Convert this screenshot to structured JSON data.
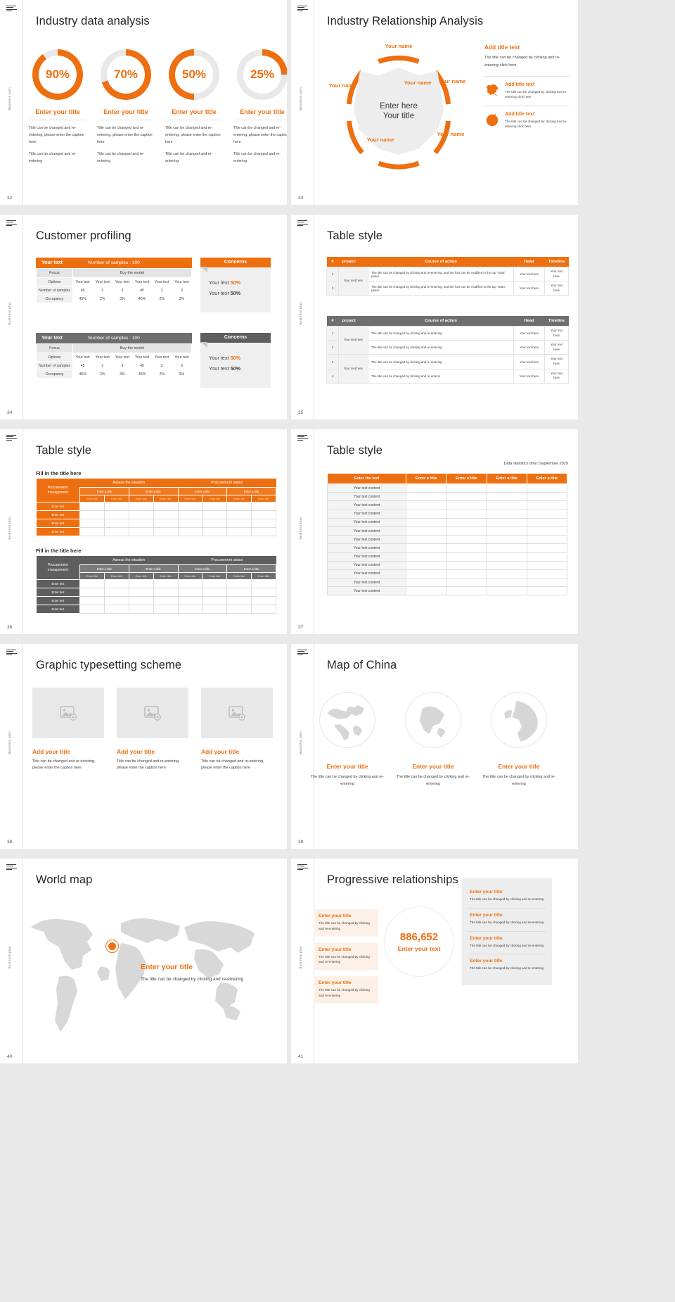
{
  "common": {
    "rail_text": "Business plan",
    "logo_name": "brand-logo"
  },
  "slides": [
    {
      "number": "32",
      "title": "Industry data analysis",
      "donuts": [
        {
          "percent": "90%",
          "value": 90,
          "title": "Enter your title",
          "body1": "Title can be changed and re-entering, please enter the caption here",
          "body2": "Title can be changed and re-entering"
        },
        {
          "percent": "70%",
          "value": 70,
          "title": "Enter your title",
          "body1": "Title can be changed and re-entering, please enter the caption here",
          "body2": "Title can be changed and re-entering"
        },
        {
          "percent": "50%",
          "value": 50,
          "title": "Enter your title",
          "body1": "Title can be changed and re-entering, please enter the caption here",
          "body2": "Title can be changed and re-entering"
        },
        {
          "percent": "25%",
          "value": 25,
          "title": "Enter your title",
          "body1": "Title can be changed and re-entering, please enter the caption here",
          "body2": "Title can be changed and re-entering"
        }
      ]
    },
    {
      "number": "33",
      "title": "Industry Relationship Analysis",
      "center_line1": "Enter here",
      "center_line2": "Your title",
      "nodes": [
        "Your name",
        "Your name",
        "Your name",
        "Your name",
        "Your name",
        "Your name"
      ],
      "right": {
        "heading": "Add title text",
        "paragraph": "The title can be changed by clicking and re-entering click here",
        "items": [
          {
            "icon": "china-map-icon",
            "heading": "Add title text",
            "paragraph": "The title can be changed by clicking and re-entering click here"
          },
          {
            "icon": "globe-icon",
            "heading": "Add title text",
            "paragraph": "The title can be changed by clicking and re-entering click here"
          }
        ]
      }
    },
    {
      "number": "34",
      "title": "Customer profiling",
      "tables": [
        {
          "accent": "#ee6f10",
          "head_left": "Your text",
          "head_right": "Number of samples : 100",
          "sub_left": "Focus",
          "sub_right": "Buy the model",
          "rows": [
            {
              "label": "Options",
              "cells": [
                "Your text",
                "Your text",
                "Your text",
                "Your text",
                "Your text",
                "Your text"
              ]
            },
            {
              "label": "Number of samples",
              "cells": [
                "45",
                "2",
                "3",
                "45",
                "2",
                "3"
              ]
            },
            {
              "label": "Occupancy",
              "cells": [
                "45%",
                "2%",
                "3%",
                "45%",
                "2%",
                "3%"
              ]
            }
          ]
        },
        {
          "accent": "#6e6e6e",
          "head_left": "Your text",
          "head_right": "Number of samples : 100",
          "sub_left": "Focus",
          "sub_right": "Buy the model",
          "rows": [
            {
              "label": "Options",
              "cells": [
                "Your text",
                "Your text",
                "Your text",
                "Your text",
                "Your text",
                "Your text"
              ]
            },
            {
              "label": "Number of samples",
              "cells": [
                "45",
                "2",
                "3",
                "45",
                "2",
                "3"
              ]
            },
            {
              "label": "Occupancy",
              "cells": [
                "45%",
                "2%",
                "3%",
                "45%",
                "2%",
                "3%"
              ]
            }
          ]
        }
      ],
      "concerns": [
        {
          "accent": "#ee6f10",
          "title": "Concerns",
          "line1_text": "Your text ",
          "line1_val": "50%",
          "line2_text": "Your text ",
          "line2_val": "50%"
        },
        {
          "accent": "#5e5e5e",
          "title": "Concerns",
          "line1_text": "Your text ",
          "line1_val": "50%",
          "line2_text": "Your text ",
          "line2_val": "50%"
        }
      ]
    },
    {
      "number": "35",
      "title": "Table style",
      "tables": [
        {
          "accent": "#ee6f10",
          "headers": [
            "#",
            "project",
            "Course of action",
            "Head",
            "Timeline"
          ],
          "rows": [
            {
              "num": "1",
              "project": "Your text here",
              "action": "The title can be changed by clicking and re-entering, and the font can be modilied in the top \"Start\" panel",
              "head": "Your text here",
              "timeline": "Your text here"
            },
            {
              "num": "2",
              "project": "",
              "action": "The title can be changed by clicking and re-entering, and the font can be modified in the top \"Start\" panel",
              "head": "Your text here",
              "timeline": "Your text here"
            }
          ]
        },
        {
          "accent": "#6e6e6e",
          "headers": [
            "#",
            "project",
            "Course of action",
            "Head",
            "Timeline"
          ],
          "rows": [
            {
              "num": "1",
              "project": "Your text here",
              "action": "The title can be changed by clicking and re-entering",
              "head": "Your text here",
              "timeline": "Your text here"
            },
            {
              "num": "2",
              "project": "",
              "action": "The title can be changed by clicking and re-entering",
              "head": "Your text here",
              "timeline": "Your text here"
            },
            {
              "num": "3",
              "project": "Your text here",
              "action": "The title can be changed by clicking and re-entering",
              "head": "Your text here",
              "timeline": "Your text here"
            },
            {
              "num": "4",
              "project": "",
              "action": "The title can be changed by clicking and re-enterin",
              "head": "Your text here",
              "timeline": "Your text here"
            }
          ]
        }
      ]
    },
    {
      "number": "36",
      "title": "Table style",
      "blocks": [
        {
          "accent": "#ee6f10",
          "caption": "Fill in the title here",
          "corner": "Procurement management",
          "groups": [
            "Assess the situation",
            "Procurement status"
          ],
          "subs": [
            "Enter a title",
            "Enter a title",
            "Enter a title",
            "Enter a title"
          ],
          "subsubs": [
            "Enter title",
            "Enter title",
            "Enter title",
            "Enter title",
            "Enter title",
            "Enter title",
            "Enter title",
            "Enter title"
          ],
          "rows": [
            "Enter text",
            "Enter text",
            "Enter text",
            "Enter text"
          ]
        },
        {
          "accent": "#5e5e5e",
          "caption": "Fill in the title here",
          "corner": "Procurement management",
          "groups": [
            "Assess the situation",
            "Procurement status"
          ],
          "subs": [
            "Enter a title",
            "Enter a title",
            "Enter a title",
            "Enter a title"
          ],
          "subsubs": [
            "Enter title",
            "Enter title",
            "Enter title",
            "Enter title",
            "Enter title",
            "Enter title",
            "Enter title",
            "Enter title"
          ],
          "rows": [
            "Enter text",
            "Enter text",
            "Enter text",
            "Enter text"
          ]
        }
      ]
    },
    {
      "number": "37",
      "title": "Table style",
      "stamp": "Data statistics time: September 2029",
      "headers": [
        "Enter the text",
        "Enter a title",
        "Enter a title",
        "Enter a title",
        "Enter a title"
      ],
      "rows": [
        "Your text content",
        "Your text content",
        "Your text content",
        "Your text content",
        "Your text content",
        "Your text content",
        "Your text content",
        "Your text content",
        "Your text content",
        "Your text content",
        "Your text content",
        "Your text content",
        "Your text content"
      ]
    },
    {
      "number": "38",
      "title": "Graphic typesetting scheme",
      "cards": [
        {
          "icon": "image-placeholder-icon",
          "heading": "Add your title",
          "body": "Title can be changed and re-entering, please enter the caption here"
        },
        {
          "icon": "image-placeholder-icon",
          "heading": "Add your title",
          "body": "Title can be changed and re-entering, please enter the caption here"
        },
        {
          "icon": "image-placeholder-icon",
          "heading": "Add your title",
          "body": "Title can be changed and re-entering, please enter the caption here"
        }
      ]
    },
    {
      "number": "39",
      "title": "Map of China",
      "globes": [
        {
          "icon": "globe-icon",
          "heading": "Enter your title",
          "body": "The title can be changed by clicking and re-entering"
        },
        {
          "icon": "globe-icon",
          "heading": "Enter your title",
          "body": "The title can be changed by clicking and re-entering"
        },
        {
          "icon": "globe-icon",
          "heading": "Enter your title",
          "body": "The title can be changed by clicking and re-entering"
        }
      ]
    },
    {
      "number": "40",
      "title": "World map",
      "pin_label": "pin-marker",
      "heading": "Enter your title",
      "body": "The title can be changed by clicking and re-entering"
    },
    {
      "number": "41",
      "title": "Progressive relationships",
      "left_cards": [
        {
          "heading": "Enter your title",
          "body": "The title can be changed by clicking and re-entering"
        },
        {
          "heading": "Enter your title",
          "body": "The title can be changed by clicking and re-entering"
        },
        {
          "heading": "Enter your title",
          "body": "The title can be changed by clicking and re-entering"
        }
      ],
      "center": {
        "number": "886,652",
        "label": "Enter your text"
      },
      "right_cards": [
        {
          "heading": "Enter your title",
          "body": "The title can be changed by clicking and re-entering"
        },
        {
          "heading": "Enter your title",
          "body": "The title can be changed by clicking and re-entering"
        },
        {
          "heading": "Enter your title",
          "body": "The title can be changed by clicking and re-entering"
        },
        {
          "heading": "Enter your title",
          "body": "The title can be changed by clicking and re-entering"
        }
      ]
    }
  ]
}
